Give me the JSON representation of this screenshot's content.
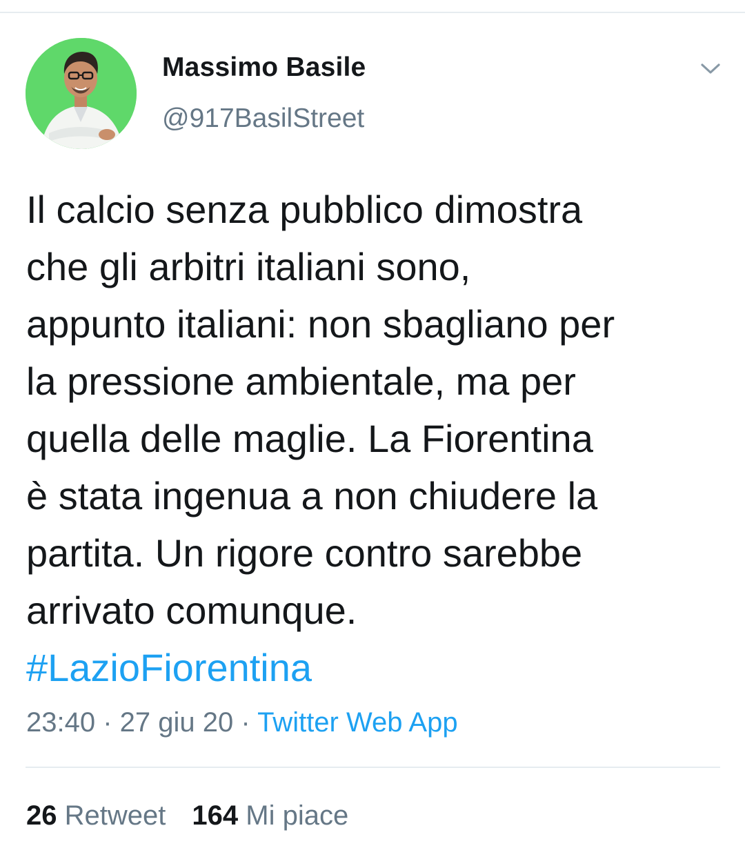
{
  "tweet": {
    "author": {
      "display_name": "Massimo Basile",
      "handle": "@917BasilStreet"
    },
    "text_lines": [
      "Il calcio senza pubblico dimostra",
      "che gli arbitri italiani sono,",
      "appunto italiani: non sbagliano per",
      "la pressione ambientale, ma per",
      "quella delle maglie. La Fiorentina",
      "è stata ingenua a non chiudere la",
      "partita. Un rigore contro sarebbe",
      "arrivato comunque."
    ],
    "hashtag": "#LazioFiorentina",
    "time": "23:40",
    "separator": " · ",
    "date": "27 giu 20",
    "source": "Twitter Web App",
    "stats": {
      "retweets_count": "26",
      "retweets_label": "Retweet",
      "likes_count": "164",
      "likes_label": "Mi piace"
    }
  },
  "icons": {
    "menu": "chevron-down-icon",
    "avatar": "profile-photo"
  },
  "colors": {
    "text": "#14171a",
    "secondary": "#657786",
    "link": "#1da1f2",
    "divider": "#e6ecf0",
    "avatar_bg": "#5fd86a"
  }
}
